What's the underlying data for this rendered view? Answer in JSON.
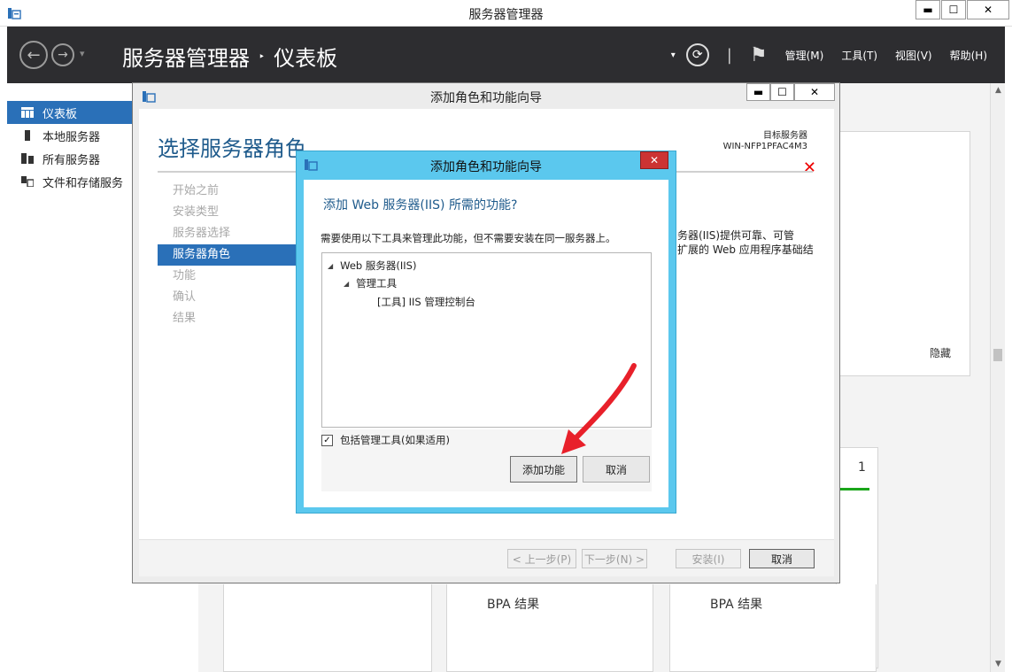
{
  "app": {
    "window_title": "服务器管理器",
    "window_controls": {
      "minimize": "▬",
      "maximize": "☐",
      "close": "✕"
    }
  },
  "header": {
    "breadcrumb": [
      "服务器管理器",
      "仪表板"
    ],
    "breadcrumb_sep": "‣",
    "dropdown_caret": "▾",
    "refresh_glyph": "⟳",
    "divider": "|",
    "flag_glyph": "⚑",
    "menus": [
      "管理(M)",
      "工具(T)",
      "视图(V)",
      "帮助(H)"
    ]
  },
  "sidebar": {
    "items": [
      {
        "label": "仪表板",
        "active": true
      },
      {
        "label": "本地服务器",
        "active": false
      },
      {
        "label": "所有服务器",
        "active": false
      },
      {
        "label": "文件和存储服务",
        "active": false
      }
    ]
  },
  "dashboard": {
    "hide_label": "隐藏",
    "tile_count": "1",
    "bpa_label_1": "BPA 结果",
    "bpa_label_2": "BPA 结果"
  },
  "wizard": {
    "title": "添加角色和功能向导",
    "heading": "选择服务器角色",
    "target_label": "目标服务器",
    "target_server": "WIN-NFP1PFAC4M3",
    "steps": [
      {
        "label": "开始之前",
        "active": false
      },
      {
        "label": "安装类型",
        "active": false
      },
      {
        "label": "服务器选择",
        "active": false
      },
      {
        "label": "服务器角色",
        "active": true
      },
      {
        "label": "功能",
        "active": false
      },
      {
        "label": "确认",
        "active": false
      },
      {
        "label": "结果",
        "active": false
      }
    ],
    "description_line1": "务器(IIS)提供可靠、可管",
    "description_line2": "扩展的 Web 应用程序基础结",
    "buttons": {
      "prev": "< 上一步(P)",
      "next": "下一步(N) >",
      "install": "安装(I)",
      "cancel": "取消"
    },
    "controls": {
      "minimize": "▬",
      "maximize": "☐",
      "close": "✕"
    },
    "warning_glyph": "✕"
  },
  "dialog": {
    "title": "添加角色和功能向导",
    "close_glyph": "✕",
    "heading": "添加 Web 服务器(IIS) 所需的功能?",
    "subtext": "需要使用以下工具来管理此功能，但不需要安装在同一服务器上。",
    "tree": [
      {
        "label": "Web 服务器(IIS)",
        "level": 0,
        "arrow": "◢"
      },
      {
        "label": "管理工具",
        "level": 1,
        "arrow": "◢"
      },
      {
        "label": "[工具] IIS 管理控制台",
        "level": 2,
        "arrow": ""
      }
    ],
    "checkbox": {
      "label": "包括管理工具(如果适用)",
      "checked": true,
      "glyph": "✓"
    },
    "buttons": {
      "add": "添加功能",
      "cancel": "取消"
    }
  },
  "colors": {
    "accent_blue": "#2a70b8",
    "dialog_frame": "#5bc8ee",
    "heading_blue": "#1f5b8c",
    "header_dark": "#2d2d30",
    "annotation_red": "#e8202a",
    "status_green": "#1aa51a"
  }
}
